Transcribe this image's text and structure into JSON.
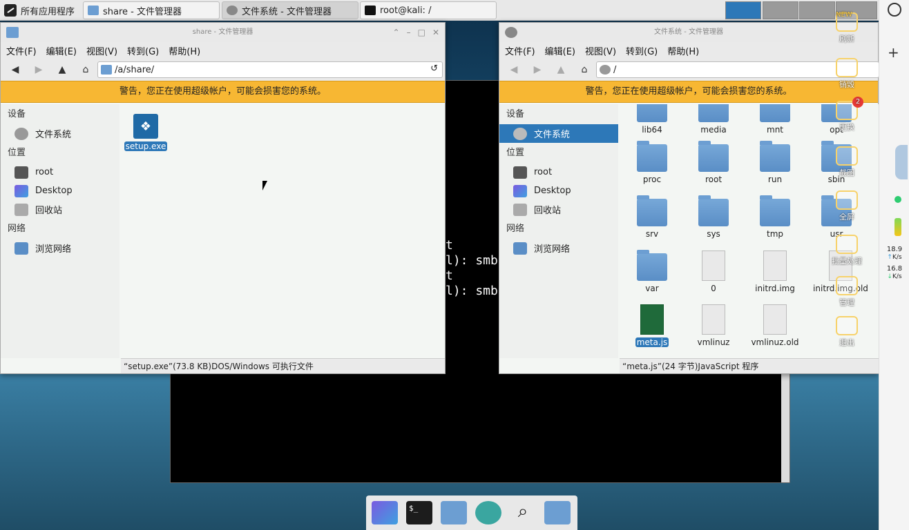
{
  "panel": {
    "apps_label": "所有应用程序",
    "tasks": [
      "share - 文件管理器",
      "文件系统 - 文件管理器",
      "root@kali: /"
    ]
  },
  "floating": {
    "items": [
      "刷新",
      "销毁",
      "更换",
      "截图",
      "全屏",
      "批量处理",
      "管理",
      "退出"
    ],
    "new_badge": "NEW",
    "notif_count": "2"
  },
  "sidebar_status": {
    "up": "18.9",
    "up_unit": "K/s",
    "down": "16.8",
    "down_unit": "K/s"
  },
  "left_win": {
    "title": "share - 文件管理器",
    "menu": [
      "文件(F)",
      "编辑(E)",
      "视图(V)",
      "转到(G)",
      "帮助(H)"
    ],
    "path": "/a/share/",
    "warning": "警告，您正在使用超级帐户，可能会损害您的系统。",
    "side_devices": "设备",
    "side_places": "位置",
    "side_network": "网络",
    "dev_items": [
      "文件系统"
    ],
    "place_items": [
      "root",
      "Desktop",
      "回收站"
    ],
    "net_items": [
      "浏览网络"
    ],
    "file": "setup.exe",
    "status": "“setup.exe”(73.8 KB)DOS/Windows 可执行文件"
  },
  "right_win": {
    "title": "文件系统 - 文件管理器",
    "path": "/",
    "files_row1": [
      "lib64",
      "media",
      "mnt",
      "opt"
    ],
    "files_row2": [
      "proc",
      "root",
      "run",
      "sbin"
    ],
    "files_row3": [
      "srv",
      "sys",
      "tmp",
      "usr"
    ],
    "files_row4": [
      "var",
      "0",
      "initrd.img",
      "initrd.img.old"
    ],
    "files_row5": [
      "meta.js",
      "vmlinuz",
      "vmlinuz.old"
    ],
    "status": "“meta.js”(24 字节)JavaScript 程序"
  },
  "terminal": {
    "title": "root@kali: /",
    "lines": [
      "t",
      "l): smb",
      "t",
      "l): smb"
    ]
  },
  "colors": {
    "accent": "#2d78b8",
    "warning": "#f7b733",
    "folder": "#6c9ed2"
  }
}
